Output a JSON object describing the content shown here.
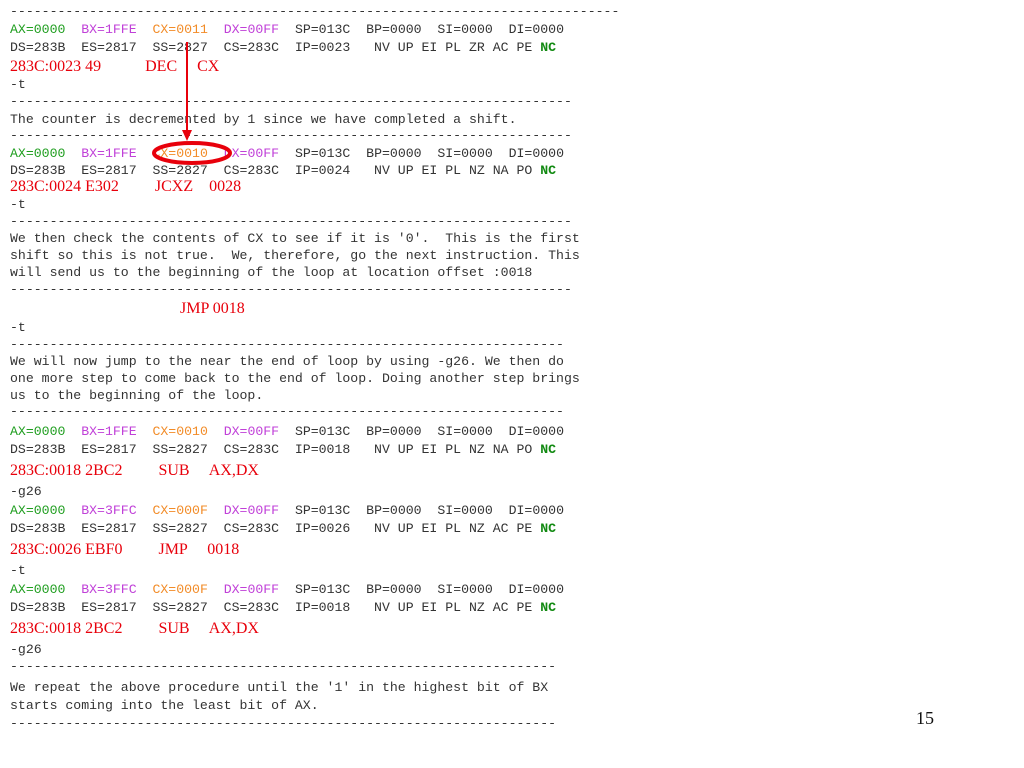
{
  "page_number": "15",
  "colors": {
    "ax": "#1f9e1f",
    "bx": "#c040d8",
    "cx": "#f28c28",
    "dx": "#c040d8",
    "nc": "#128a12",
    "asm": "#e8000b",
    "highlight": "#e8000b"
  },
  "separators": {
    "s0": "-----------------------------------------------------------------------------",
    "s1": "-----------------------------------------------------------------------",
    "s2": "-----------------------------------------------------------------------",
    "s3": "-----------------------------------------------------------------------",
    "s4": "-----------------------------------------------------------------------",
    "s5": "----------------------------------------------------------------------",
    "s6": "----------------------------------------------------------------------",
    "s7": "---------------------------------------------------------------------",
    "s8": "---------------------------------------------------------------------"
  },
  "reg_blocks": [
    {
      "ax": "AX=0000",
      "bx": "BX=1FFE",
      "cx": "CX=0011",
      "dx": "DX=00FF",
      "rest1": "SP=013C  BP=0000  SI=0000  DI=0000",
      "seg": "DS=283B  ES=2817  SS=2827  CS=283C  IP=0023   NV UP EI PL ZR AC PE",
      "nc": "NC",
      "asm": "283C:0023 49           DEC     CX"
    },
    {
      "ax": "AX=0000",
      "bx": "BX=1FFE",
      "cx": "CX=0010",
      "dx": "DX=00FF",
      "rest1": "SP=013C  BP=0000  SI=0000  DI=0000",
      "seg": "DS=283B  ES=2817  SS=2827  CS=283C  IP=0024   NV UP EI PL NZ NA PO",
      "nc": "NC",
      "asm": "283C:0024 E302         JCXZ    0028"
    },
    {
      "ax": "AX=0000",
      "bx": "BX=1FFE",
      "cx": "CX=0010",
      "dx": "DX=00FF",
      "rest1": "SP=013C  BP=0000  SI=0000  DI=0000",
      "seg": "DS=283B  ES=2817  SS=2827  CS=283C  IP=0018   NV UP EI PL NZ NA PO",
      "nc": "NC",
      "asm": "283C:0018 2BC2         SUB     AX,DX"
    },
    {
      "ax": "AX=0000",
      "bx": "BX=3FFC",
      "cx": "CX=000F",
      "dx": "DX=00FF",
      "rest1": "SP=013C  BP=0000  SI=0000  DI=0000",
      "seg": "DS=283B  ES=2817  SS=2827  CS=283C  IP=0026   NV UP EI PL NZ AC PE",
      "nc": "NC",
      "asm": "283C:0026 EBF0         JMP     0018"
    },
    {
      "ax": "AX=0000",
      "bx": "BX=3FFC",
      "cx": "CX=000F",
      "dx": "DX=00FF",
      "rest1": "SP=013C  BP=0000  SI=0000  DI=0000",
      "seg": "DS=283B  ES=2817  SS=2827  CS=283C  IP=0018   NV UP EI PL NZ AC PE",
      "nc": "NC",
      "asm": "283C:0018 2BC2         SUB     AX,DX"
    }
  ],
  "commands": {
    "c1": "-t",
    "c2": "-t",
    "c3": "-t",
    "c4": "-g26",
    "c5": "-t",
    "c6": "-g26"
  },
  "jmp_annotation": "JMP 0018",
  "notes": {
    "n1": "The counter is decremented by 1 since we have completed a shift.",
    "n2_1": "We then check the contents of CX to see if it is '0'.  This is the first",
    "n2_2": "shift so this is not true.  We, therefore, go the next instruction. This",
    "n2_3": "will send us to the beginning of the loop at location offset :0018",
    "n3_1": "We will now jump to the near the end of loop by using -g26. We then do",
    "n3_2": "one more step to come back to the end of loop. Doing another step brings",
    "n3_3": "us to the beginning of the loop.",
    "n4_1": "We repeat the above procedure until the '1' in the highest bit of BX",
    "n4_2": "starts coming into the least bit of AX."
  }
}
